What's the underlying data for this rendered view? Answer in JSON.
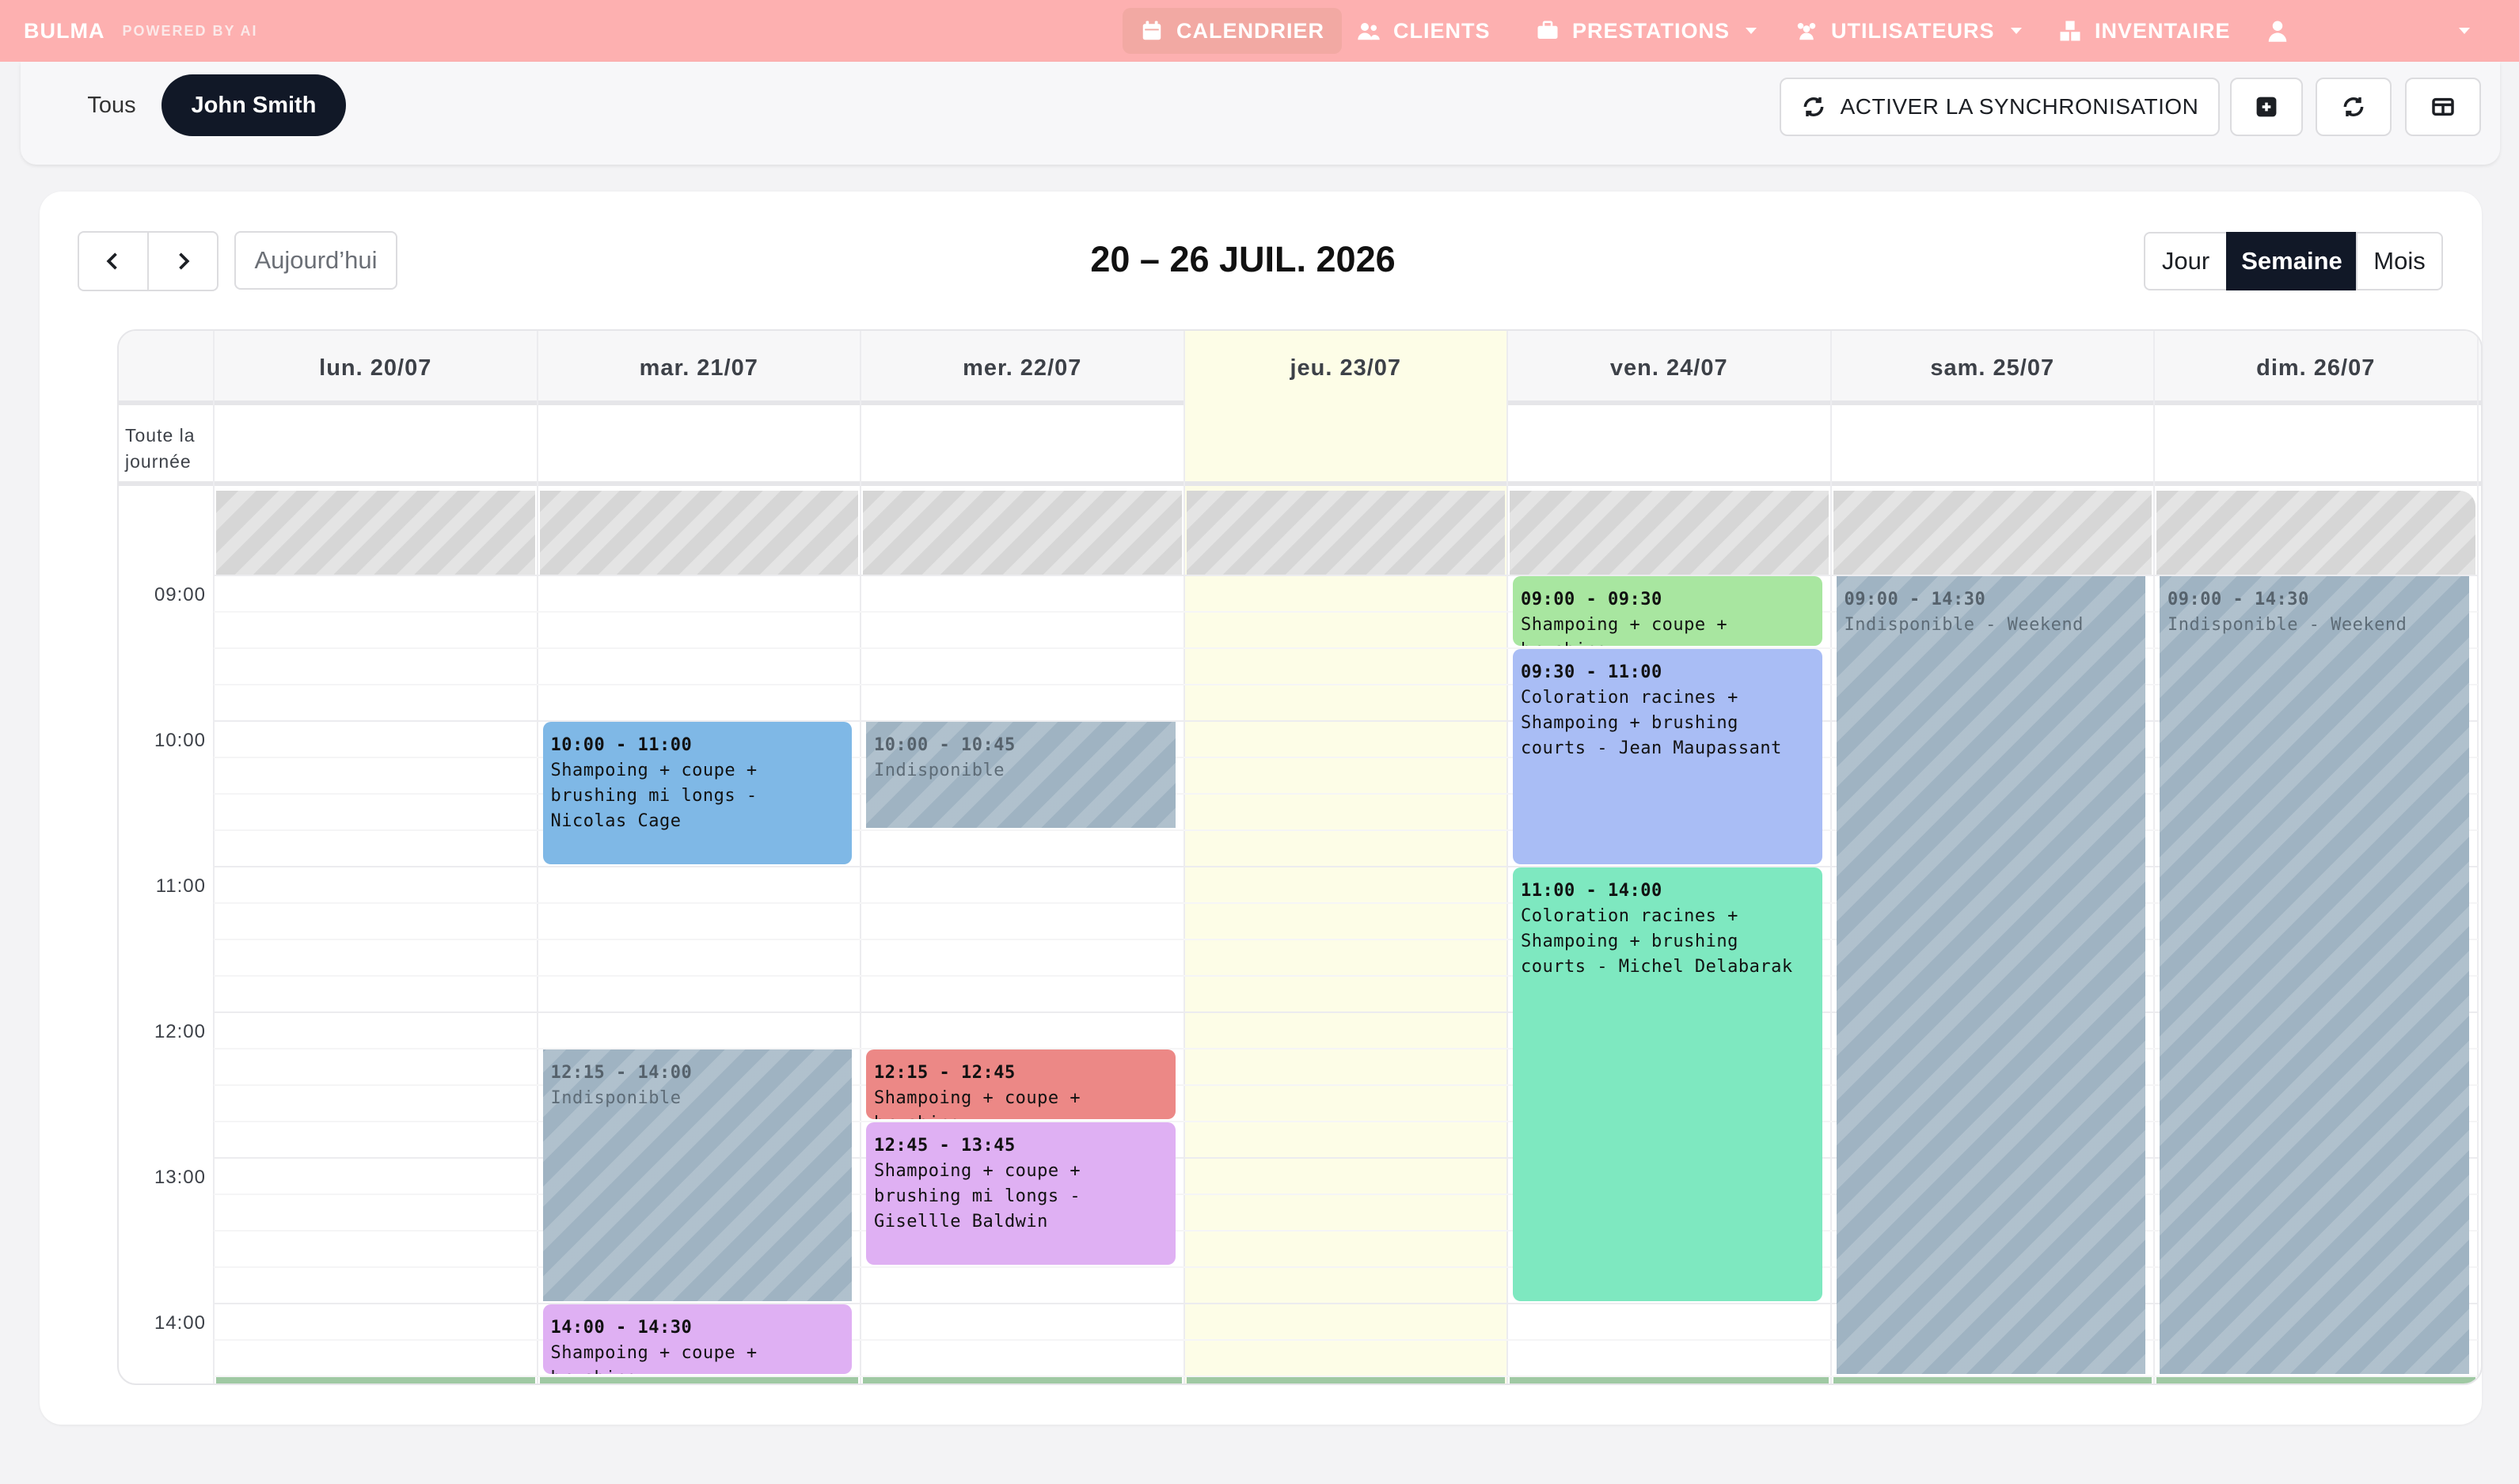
{
  "navbar": {
    "brand": "BULMA",
    "brand_sub": "POWERED BY AI",
    "items": [
      {
        "label": "CALENDRIER"
      },
      {
        "label": "CLIENTS"
      },
      {
        "label": "PRESTATIONS"
      },
      {
        "label": "UTILISATEURS"
      },
      {
        "label": "INVENTAIRE"
      }
    ]
  },
  "filters": {
    "all": "Tous",
    "selected": "John Smith"
  },
  "toolbar": {
    "sync_label": "ACTIVER LA SYNCHRONISATION"
  },
  "calendar": {
    "today_label": "Aujourd’hui",
    "title": "20 – 26 JUIL. 2026",
    "views": [
      "Jour",
      "Semaine",
      "Mois"
    ],
    "active_view": "Semaine",
    "all_day_label": "Toute la journée",
    "days": [
      "lun. 20/07",
      "mar. 21/07",
      "mer. 22/07",
      "jeu. 23/07",
      "ven. 24/07",
      "sam. 25/07",
      "dim. 26/07"
    ],
    "today_index": 3,
    "hours": [
      "09:00",
      "10:00",
      "11:00",
      "12:00",
      "13:00",
      "14:00"
    ],
    "events": [
      {
        "day": 1,
        "start": "10:00",
        "end": "11:00",
        "time": "10:00 - 11:00",
        "title": "Shampoing + coupe + brushing mi longs - Nicolas Cage",
        "color": "#7fb8e6",
        "unavailable": false
      },
      {
        "day": 1,
        "start": "12:15",
        "end": "14:00",
        "time": "12:15 - 14:00",
        "title": "Indisponible",
        "color": "#9fb3c2",
        "unavailable": true
      },
      {
        "day": 1,
        "start": "14:00",
        "end": "14:30",
        "time": "14:00 - 14:30",
        "title": "Shampoing + coupe + brushing",
        "color": "#dfb0f3",
        "unavailable": false
      },
      {
        "day": 2,
        "start": "10:00",
        "end": "10:45",
        "time": "10:00 - 10:45",
        "title": "Indisponible",
        "color": "#9fb3c2",
        "unavailable": true
      },
      {
        "day": 2,
        "start": "12:15",
        "end": "12:45",
        "time": "12:15 - 12:45",
        "title": "Shampoing + coupe + brushing",
        "color": "#ec8886",
        "unavailable": false
      },
      {
        "day": 2,
        "start": "12:45",
        "end": "13:45",
        "time": "12:45 - 13:45",
        "title": "Shampoing + coupe + brushing mi longs - Gisellle Baldwin",
        "color": "#dfb0f3",
        "unavailable": false
      },
      {
        "day": 4,
        "start": "09:00",
        "end": "09:30",
        "time": "09:00 - 09:30",
        "title": "Shampoing + coupe + brushing",
        "color": "#a8e6a0",
        "unavailable": false
      },
      {
        "day": 4,
        "start": "09:30",
        "end": "11:00",
        "time": "09:30 - 11:00",
        "title": "Coloration racines + Shampoing + brushing courts - Jean Maupassant",
        "color": "#a9bdf5",
        "unavailable": false
      },
      {
        "day": 4,
        "start": "11:00",
        "end": "14:00",
        "time": "11:00 - 14:00",
        "title": "Coloration racines + Shampoing + brushing courts - Michel Delabarak",
        "color": "#7ee8c0",
        "unavailable": false
      },
      {
        "day": 5,
        "start": "09:00",
        "end": "14:30",
        "time": "09:00 - 14:30",
        "title": "Indisponible - Weekend",
        "color": "#9fb3c2",
        "unavailable": true
      },
      {
        "day": 6,
        "start": "09:00",
        "end": "14:30",
        "time": "09:00 - 14:30",
        "title": "Indisponible - Weekend",
        "color": "#9fb3c2",
        "unavailable": true
      }
    ]
  }
}
